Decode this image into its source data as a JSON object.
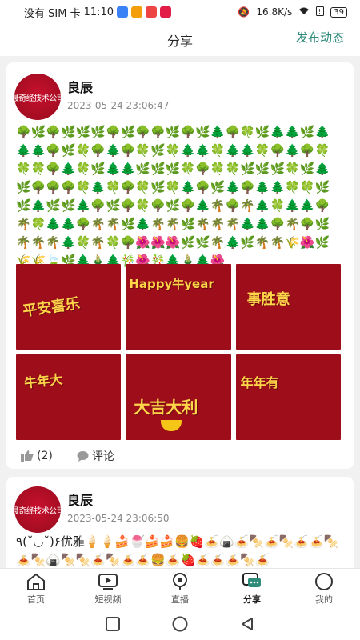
{
  "status_bar": {
    "carrier": "没有 SIM 卡",
    "time": "11:10",
    "net_speed": "16.8K/s",
    "battery": "39"
  },
  "header": {
    "title": "分享",
    "publish_label": "发布动态"
  },
  "posts": [
    {
      "avatar_text": "聂奇经技术公司",
      "author": "良辰",
      "time": "2023-05-24 23:06:47",
      "emoji_text": "🌳🌿🌳🌿🌿🌿🌳🌿🌳🌳🌿🌳🌿🌲🌳🍀🌿🌲🌲🌿🌲🌲🌲🌳🌿🍀🌳🌲🌳🍀🌿🍀🌲🌲🍀🌲🌲🍀🌳🌲🌳🍀🍀🍀🌳🌲🍀🌿🌲🌲🌿🌿🌿🍀🌳🍀🍀🌿🌿🌿🍀🌿🌲🌿🌳🌳🌳🍀🌲🍀🌳🍀🌿🍀🌲🌳🌿🌲🌳🌲🌲🍀🍀🌿🌿🌲🌿🌿🌲🌳🌿🌳🍀🌳🌿🌳🌲🌴🌳🌴🌲🍀🌲🌲🌳🌴🍀🌲🌲🌳🌴🌴🌿🌲🌴🌴🌿🌴🌴🌴🌲🌲🌳🌴🌳🌿🌴🌴🌴🌲🍀🌴🍀🌳🌺🌺🌺🌿🌿🌴🌲🌿🌴🌴🌾🌺🌿🌾🌾🍃🌿🌲🎍🌲🎋🌺🎋🌲🎍🌲🌺",
      "images": [
        {
          "text": "平安喜乐"
        },
        {
          "text": "Happy牛year"
        },
        {
          "text": "事胜意"
        },
        {
          "text": "牛年大"
        },
        {
          "text": "大吉大利"
        },
        {
          "text": "年年有"
        }
      ],
      "likes": "(2)",
      "comment_label": "评论"
    },
    {
      "avatar_text": "聂奇经技术公司",
      "author": "良辰",
      "time": "2023-05-24 23:06:50",
      "emoji_text": "٩(˘◡˘)۶优雅🍦🍦🍰🍧🍰🍰🍔🍓🍝🍙🍝🍢🍝🍢🍝🍝🍢🍝🍢🍙🍢🍢🍝🍢🍝🍝🍔🍝🍓🍝🍝🍝🍢🍝"
    }
  ],
  "bottom_nav": [
    {
      "label": "首页"
    },
    {
      "label": "短视频"
    },
    {
      "label": "直播"
    },
    {
      "label": "分享"
    },
    {
      "label": "我的"
    }
  ],
  "colors": {
    "accent": "#2e8b7a",
    "card_red": "#9e0d1a",
    "text_gold": "#ffd54a"
  }
}
